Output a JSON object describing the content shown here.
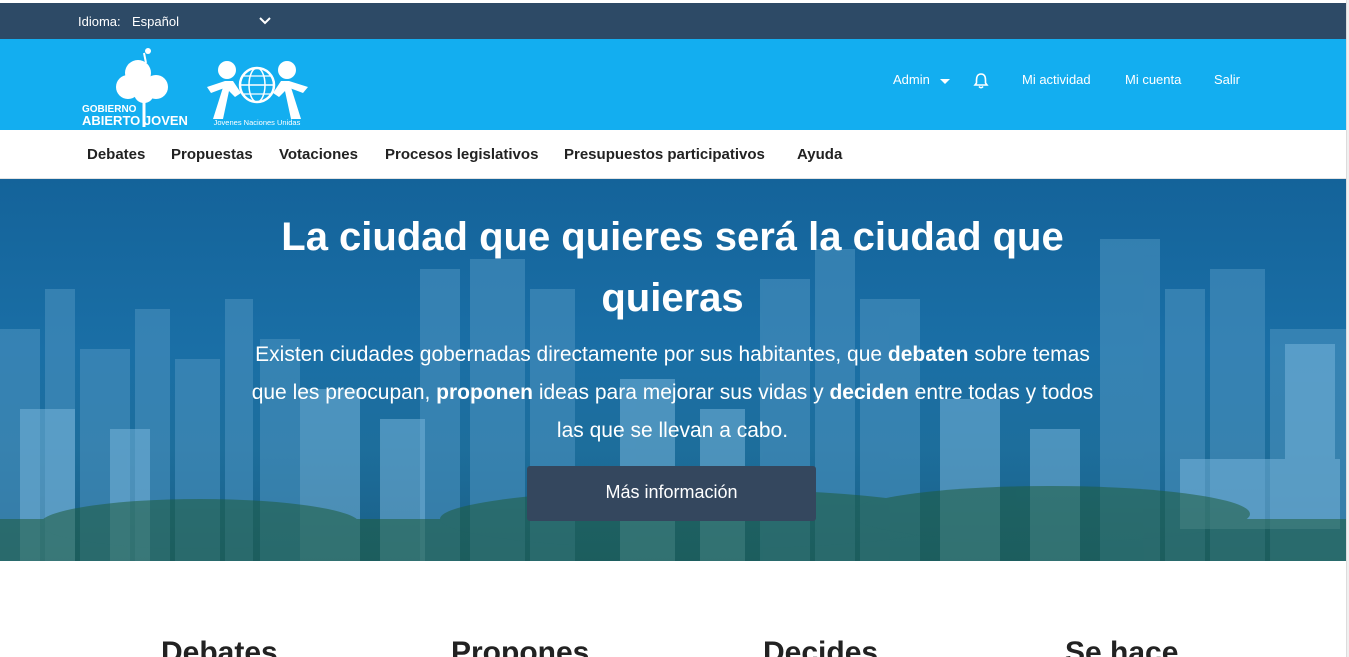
{
  "language_bar": {
    "label": "Idioma:",
    "selected": "Español"
  },
  "header": {
    "logo_text_line1": "GOBIERNO",
    "logo_text_line2": "ABIERTO JOVEN",
    "logo2_caption": "Jovenes Naciones Unidas",
    "links": {
      "admin": "Admin",
      "activity": "Mi actividad",
      "account": "Mi cuenta",
      "logout": "Salir"
    }
  },
  "nav": [
    "Debates",
    "Propuestas",
    "Votaciones",
    "Procesos legislativos",
    "Presupuestos participativos",
    "Ayuda"
  ],
  "hero": {
    "title": "La ciudad que quieres será la ciudad que quieras",
    "text_1": "Existen ciudades gobernadas directamente por sus habitantes, que ",
    "bold_1": "debaten",
    "text_2": " sobre temas que les preocupan, ",
    "bold_2": "proponen",
    "text_3": " ideas para mejorar sus vidas y ",
    "bold_3": "deciden",
    "text_4": " entre todas y todos las que se llevan a cabo.",
    "button": "Más información"
  },
  "sections": [
    "Debates",
    "Propones",
    "Decides",
    "Se hace"
  ],
  "colors": {
    "lang_bar": "#2d4a66",
    "brand": "#13aef0",
    "button": "#34475e"
  }
}
